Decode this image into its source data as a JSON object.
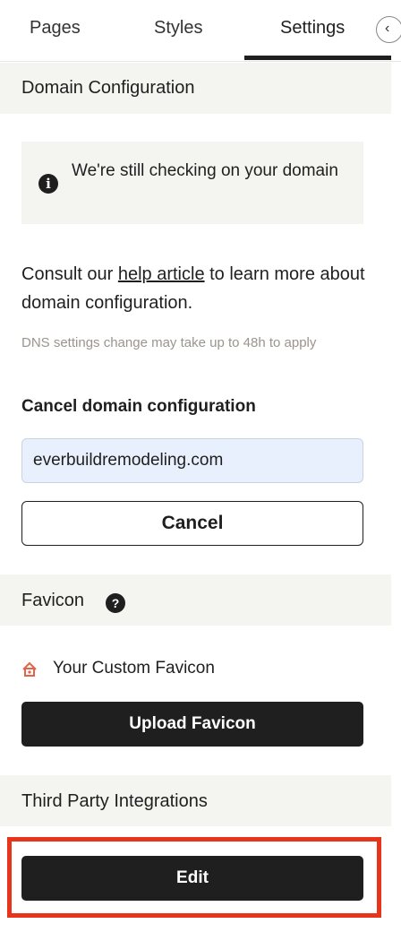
{
  "tabs": [
    {
      "label": "Pages",
      "active": false
    },
    {
      "label": "Styles",
      "active": false
    },
    {
      "label": "Settings",
      "active": true
    }
  ],
  "panel_toggle_icon": "chevron-left-icon",
  "domain": {
    "header": "Domain Configuration",
    "notice_icon": "info-icon",
    "notice": "We're still checking on your domain",
    "help_prefix": "Consult our ",
    "help_link": "help article",
    "help_suffix": " to learn more about domain configuration.",
    "hint": "DNS settings change may take up to 48h to apply",
    "cancel_title": "Cancel domain configuration",
    "domain_value": "everbuildremodeling.com",
    "cancel_button": "Cancel"
  },
  "favicon": {
    "header": "Favicon",
    "help_icon": "question-mark-icon",
    "label": "Your Custom Favicon",
    "icon": "home-icon",
    "upload_button": "Upload Favicon"
  },
  "integrations": {
    "header": "Third Party Integrations",
    "edit_button": "Edit"
  },
  "colors": {
    "dark": "#1f1f1f",
    "section_bg": "#f4f4f1",
    "input_bg": "#e8f0fd",
    "highlight": "#e8341c",
    "favicon_accent": "#e2634a"
  }
}
